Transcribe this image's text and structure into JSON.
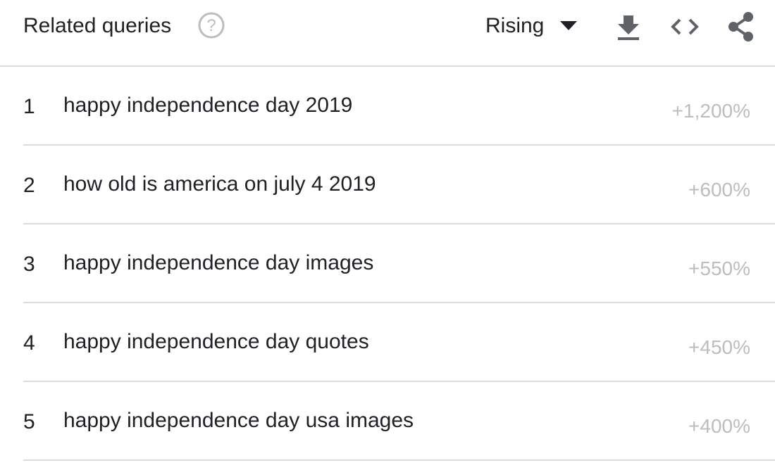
{
  "header": {
    "title": "Related queries",
    "help_icon": "help-circle-icon",
    "dropdown_selected": "Rising",
    "dropdown_icon": "caret-down-icon",
    "tools": [
      {
        "name": "download-icon"
      },
      {
        "name": "embed-code-icon"
      },
      {
        "name": "share-icon"
      }
    ]
  },
  "rows": [
    {
      "rank": "1",
      "query": "happy independence day 2019",
      "value": "+1,200%"
    },
    {
      "rank": "2",
      "query": "how old is america on july 4 2019",
      "value": "+600%"
    },
    {
      "rank": "3",
      "query": "happy independence day images",
      "value": "+550%"
    },
    {
      "rank": "4",
      "query": "happy independence day quotes",
      "value": "+450%"
    },
    {
      "rank": "5",
      "query": "happy independence day usa images",
      "value": "+400%"
    }
  ],
  "colors": {
    "text_primary": "#202124",
    "text_value": "#bdbdbd",
    "divider": "#dadce0",
    "icon": "#5f6368",
    "help_icon": "#bdbdbd"
  }
}
